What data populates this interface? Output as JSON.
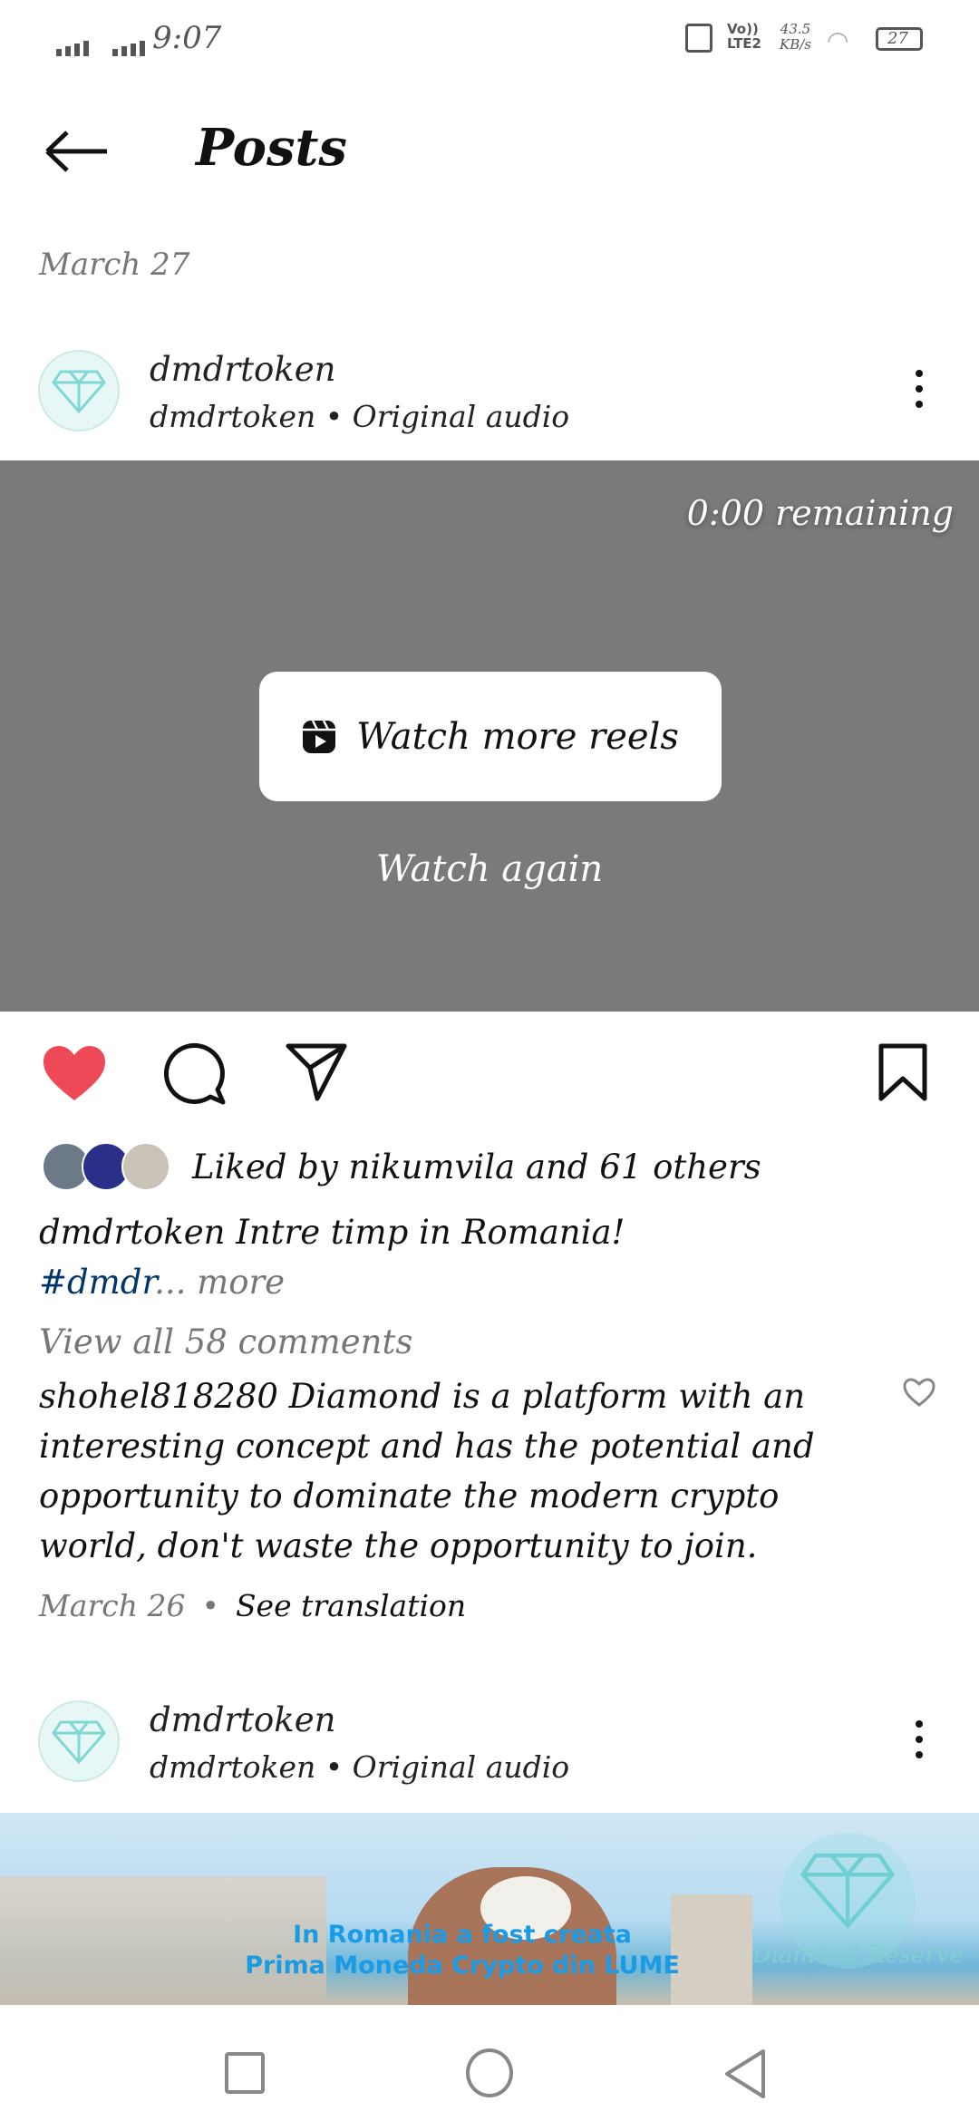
{
  "status_bar": {
    "time": "9:07",
    "net_speed": "43.5",
    "net_unit": "KB/s",
    "lte": "LTE2",
    "volte": "Vo))",
    "battery": "27"
  },
  "header": {
    "title": "Posts"
  },
  "date_label": "March 27",
  "post1": {
    "username": "dmdrtoken",
    "subtitle": "dmdrtoken • Original audio",
    "video": {
      "remaining": "0:00 remaining",
      "watch_more": "Watch more reels",
      "watch_again": "Watch again"
    },
    "liked_by": "Liked by nikumvila and 61 others",
    "caption_user": "dmdrtoken",
    "caption_text": " Intre timp in Romania!",
    "hashtag": "#dmdr",
    "more": "... more",
    "view_comments": "View all 58 comments",
    "comment": {
      "user": "shohel818280",
      "lines": [
        " Diamond is a platform with an",
        "interesting concept and has the potential and",
        "opportunity to dominate the modern crypto",
        "world, don't waste the opportunity to join."
      ]
    },
    "comment_date": "March 26",
    "see_translation": "See translation",
    "liked": true,
    "colors": {
      "like": "#ed4956",
      "hashtag": "#00376b"
    }
  },
  "post2": {
    "username": "dmdrtoken",
    "subtitle": "dmdrtoken • Original audio",
    "image_text": [
      "In Romania a fost creata",
      "Prima Moneda Crypto din LUME"
    ],
    "watermark": "Diamond Reserve"
  },
  "nav": {
    "icons": [
      "recents-square-icon",
      "home-circle-icon",
      "back-triangle-icon"
    ]
  }
}
